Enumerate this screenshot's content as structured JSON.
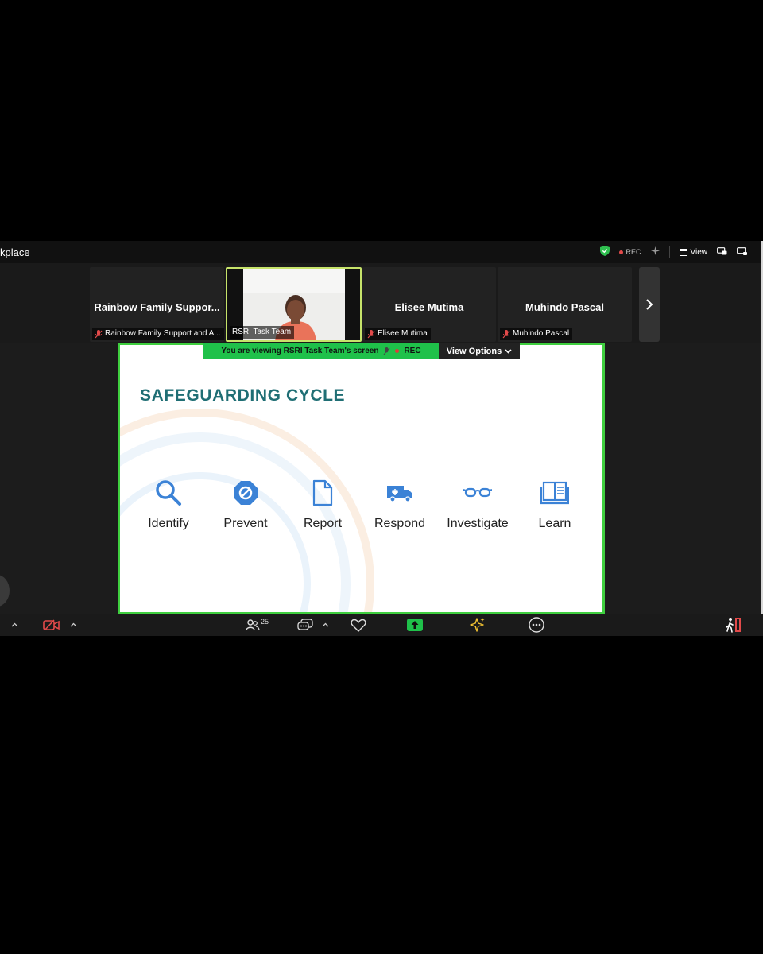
{
  "window": {
    "title": "kplace",
    "rec_label": "REC",
    "view_label": "View"
  },
  "participants": [
    {
      "name": "Rainbow Family Suppor...",
      "label": "Rainbow Family Support and A...",
      "muted": true
    },
    {
      "name": "",
      "label": "RSRI Task Team",
      "muted": false,
      "active": true
    },
    {
      "name": "Elisee Mutima",
      "label": "Elisee Mutima",
      "muted": true
    },
    {
      "name": "Muhindo Pascal",
      "label": "Muhindo Pascal",
      "muted": true
    }
  ],
  "share": {
    "banner_text": "You are viewing  RSRI Task Team's screen",
    "banner_rec": "REC",
    "view_options": "View Options"
  },
  "slide": {
    "title": "SAFEGUARDING CYCLE",
    "steps": [
      {
        "label": "Identify",
        "icon": "magnifier-icon"
      },
      {
        "label": "Prevent",
        "icon": "prohibit-icon"
      },
      {
        "label": "Report",
        "icon": "document-icon"
      },
      {
        "label": "Respond",
        "icon": "ambulance-icon"
      },
      {
        "label": "Investigate",
        "icon": "glasses-icon"
      },
      {
        "label": "Learn",
        "icon": "book-icon"
      }
    ]
  },
  "toolbar": {
    "participants_count": "25"
  },
  "colors": {
    "slide_title": "#1f6e74",
    "slide_icon": "#3b82d6",
    "share_border": "#3fcf3f",
    "banner_bg": "#1fc14a"
  }
}
